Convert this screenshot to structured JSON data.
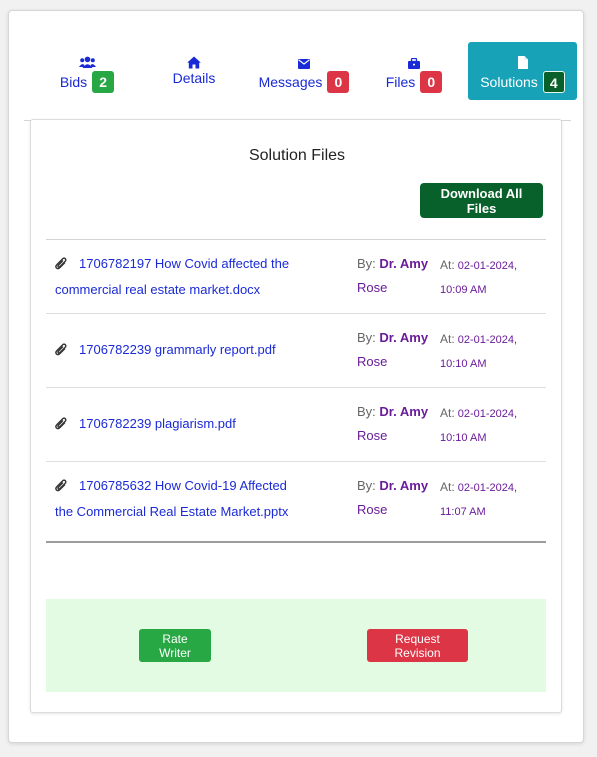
{
  "tabs": [
    {
      "label": "Bids",
      "icon": "users-icon",
      "badge": "2",
      "badge_color": "#28a745"
    },
    {
      "label": "Details",
      "icon": "home-icon",
      "badge": null
    },
    {
      "label": "Messages",
      "icon": "envelope-icon",
      "badge": "0",
      "badge_color": "#dc3545"
    },
    {
      "label": "Files",
      "icon": "briefcase-icon",
      "badge": "0",
      "badge_color": "#dc3545"
    },
    {
      "label": "Solutions",
      "icon": "file-icon",
      "badge": "4",
      "badge_color": "#08612a",
      "active": true,
      "active_color": "#17a2b8"
    }
  ],
  "solutions": {
    "title": "Solution Files",
    "download_all_label": "Download All Files",
    "files": [
      {
        "name": "1706782197 How Covid affected the commercial real estate market.docx",
        "by_label": "By:",
        "author": "Dr. Amy",
        "author2": "Rose",
        "at_label": "At:",
        "date": "02-01-2024,",
        "time": "10:09 AM"
      },
      {
        "name": "1706782239 grammarly report.pdf",
        "by_label": "By:",
        "author": "Dr. Amy",
        "author2": "Rose",
        "at_label": "At:",
        "date": "02-01-2024,",
        "time": "10:10 AM"
      },
      {
        "name": "1706782239 plagiarism.pdf",
        "by_label": "By:",
        "author": "Dr. Amy",
        "author2": "Rose",
        "at_label": "At:",
        "date": "02-01-2024,",
        "time": "10:10 AM"
      },
      {
        "name": "1706785632 How Covid-19 Affected the Commercial Real Estate Market.pptx",
        "by_label": "By:",
        "author": "Dr. Amy",
        "author2": "Rose",
        "at_label": "At:",
        "date": "02-01-2024,",
        "time": "11:07 AM"
      }
    ]
  },
  "actions": {
    "rate_label": "Rate Writer",
    "revision_label": "Request Revision"
  },
  "colors": {
    "link": "#1a2ad6",
    "author": "#6a1b9a",
    "action_bg": "#e3fbe3"
  }
}
